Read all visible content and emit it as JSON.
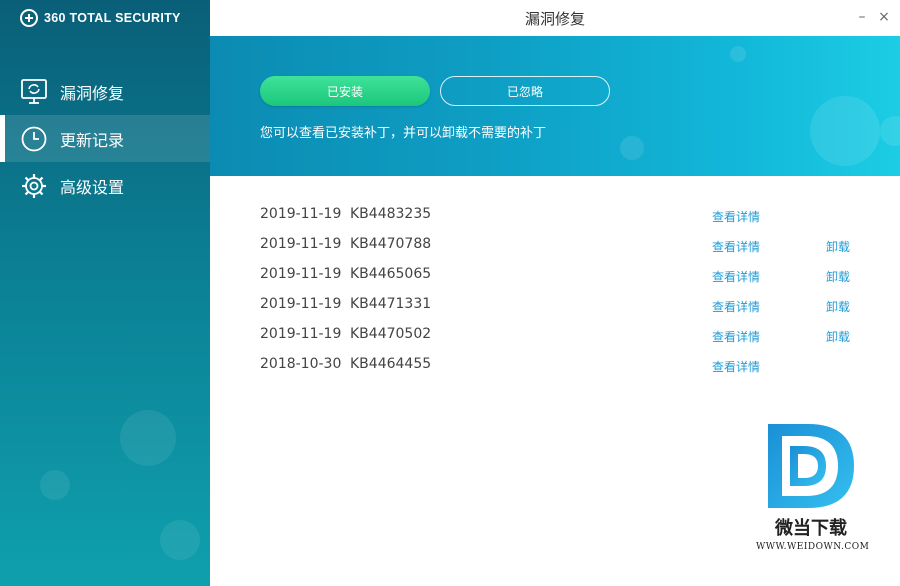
{
  "app": {
    "brand": "360 TOTAL SECURITY",
    "window_title": "漏洞修复"
  },
  "window_controls": {
    "minimize": "–",
    "close": "×"
  },
  "sidebar": {
    "items": [
      {
        "label": "漏洞修复",
        "icon": "monitor-refresh-icon",
        "active": false
      },
      {
        "label": "更新记录",
        "icon": "clock-icon",
        "active": true
      },
      {
        "label": "高级设置",
        "icon": "gear-icon",
        "active": false
      }
    ]
  },
  "banner": {
    "installed_button": "已安装",
    "ignored_button": "已忽略",
    "description": "您可以查看已安装补丁，并可以卸载不需要的补丁"
  },
  "patches": [
    {
      "date": "2019-11-19",
      "kb": "KB4483235",
      "details": "查看详情",
      "uninstall": ""
    },
    {
      "date": "2019-11-19",
      "kb": "KB4470788",
      "details": "查看详情",
      "uninstall": "卸载"
    },
    {
      "date": "2019-11-19",
      "kb": "KB4465065",
      "details": "查看详情",
      "uninstall": "卸载"
    },
    {
      "date": "2019-11-19",
      "kb": "KB4471331",
      "details": "查看详情",
      "uninstall": "卸载"
    },
    {
      "date": "2019-11-19",
      "kb": "KB4470502",
      "details": "查看详情",
      "uninstall": "卸载"
    },
    {
      "date": "2018-10-30",
      "kb": "KB4464455",
      "details": "查看详情",
      "uninstall": ""
    }
  ],
  "watermark": {
    "name": "微当下载",
    "url": "WWW.WEIDOWN.COM"
  },
  "colors": {
    "accent_green": "#1bc77c",
    "link_blue": "#1f9bd7",
    "sidebar_teal": "#0b7f94"
  }
}
